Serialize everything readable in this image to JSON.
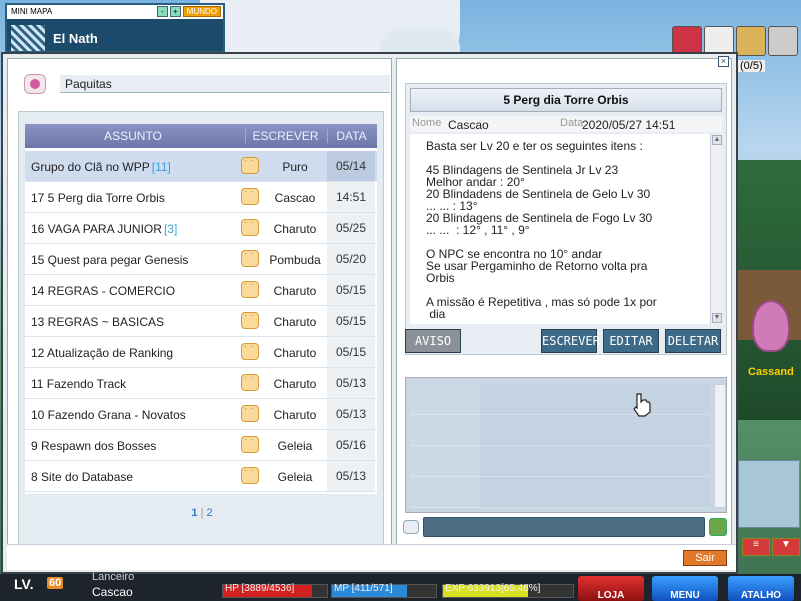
{
  "minimap": {
    "title": "MINI MAPA",
    "world_button": "MUNDO",
    "location": "El Nath"
  },
  "top_counter": "(0/5)",
  "window": {
    "tab_label": "Paquitas",
    "list_header": {
      "subject": "ASSUNTO",
      "writer": "ESCREVER",
      "date": "DATA"
    },
    "rows": [
      {
        "subject": "Grupo do Clã no WPP",
        "count": "[11]",
        "writer": "Puro",
        "date": "05/14",
        "selected": true
      },
      {
        "subject": "17 5 Perg dia Torre Orbis",
        "count": "",
        "writer": "Cascao",
        "date": "14:51"
      },
      {
        "subject": "16 VAGA PARA JUNIOR",
        "count": "[3]",
        "writer": "Charuto",
        "date": "05/25"
      },
      {
        "subject": "15 Quest para pegar Genesis",
        "count": "",
        "writer": "Pombuda",
        "date": "05/20"
      },
      {
        "subject": "14 REGRAS - COMERCIO",
        "count": "",
        "writer": "Charuto",
        "date": "05/15"
      },
      {
        "subject": "13 REGRAS ~ BASICAS",
        "count": "",
        "writer": "Charuto",
        "date": "05/15"
      },
      {
        "subject": "12 Atualização de Ranking",
        "count": "",
        "writer": "Charuto",
        "date": "05/15"
      },
      {
        "subject": "11 Fazendo Track",
        "count": "",
        "writer": "Charuto",
        "date": "05/13"
      },
      {
        "subject": "10 Fazendo Grana - Novatos",
        "count": "",
        "writer": "Charuto",
        "date": "05/13"
      },
      {
        "subject": "9 Respawn dos Bosses",
        "count": "",
        "writer": "Geleia",
        "date": "05/16"
      },
      {
        "subject": "8 Site do Database",
        "count": "",
        "writer": "Geleia",
        "date": "05/13"
      }
    ],
    "pager": {
      "current": "1",
      "separator": "|",
      "other": "2"
    },
    "post": {
      "title": "5 Perg dia Torre Orbis",
      "name_label": "Nome",
      "name_value": "Cascao",
      "date_label": "Data",
      "date_value": "2020/05/27 14:51",
      "body": "Basta ser Lv 20 e ter os seguintes itens :\n\n45 Blindagens de Sentinela Jr Lv 23\nMelhor andar : 20°\n20 Blindadens de Sentinela de Gelo Lv 30\n... ... : 13°\n20 Blindagens de Sentinela de Fogo Lv 30\n... ...  : 12° , 11° , 9°\n\nO NPC se encontra no 10° andar\nSe usar Pergaminho de Retorno volta pra\nOrbis\n\nA missão é Repetitiva , mas só pode 1x por\n dia"
    },
    "buttons": {
      "aviso": "AVISO",
      "escrever": "ESCREVER",
      "editar": "EDITAR",
      "deletar": "DELETAR"
    },
    "exit_button": "Sair"
  },
  "side": {
    "npc_name": "Cassand"
  },
  "status": {
    "lv_label": "LV.",
    "lv_value": "60",
    "job": "Lanceiro",
    "char_name": "Cascao",
    "hp_text": "HP [3889/4536]",
    "mp_text": "MP [411/571]",
    "exp_text": "EXP 633913[65.48%]",
    "hp_ratio": 0.857,
    "mp_ratio": 0.72,
    "exp_ratio": 0.6548,
    "loja": "LOJA",
    "menu": "MENU",
    "atalho": "ATALHO"
  }
}
